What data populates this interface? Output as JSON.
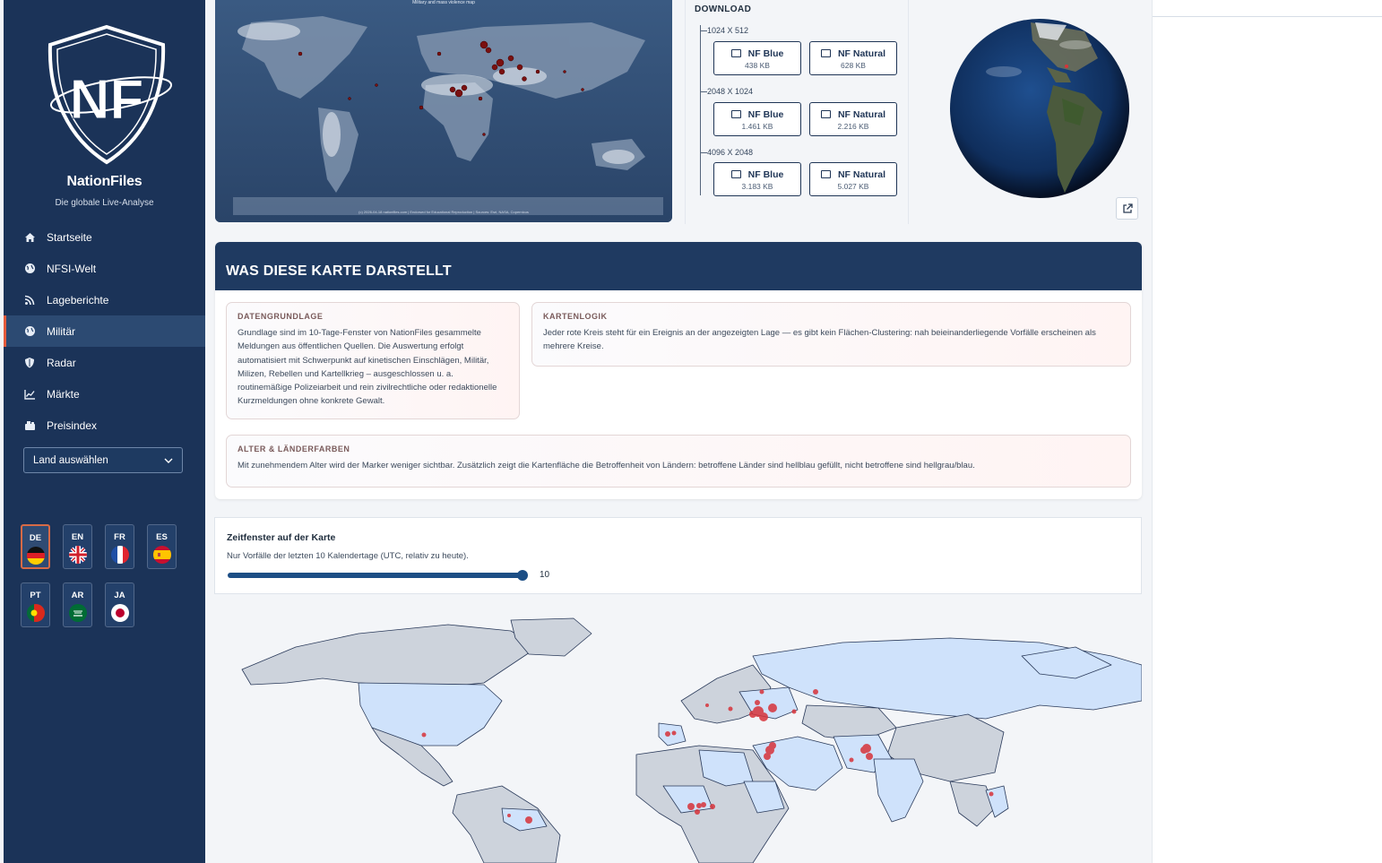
{
  "sidebar": {
    "brand": "NationFiles",
    "logo_text": "NF",
    "tagline": "Die globale Live-Analyse",
    "nav": [
      {
        "label": "Startseite",
        "icon": "home-icon"
      },
      {
        "label": "NFSI-Welt",
        "icon": "globe-icon"
      },
      {
        "label": "Lageberichte",
        "icon": "rss-icon"
      },
      {
        "label": "Militär",
        "icon": "globe-icon",
        "active": true
      },
      {
        "label": "Radar",
        "icon": "shield-icon"
      },
      {
        "label": "Märkte",
        "icon": "chart-line-icon"
      },
      {
        "label": "Preisindex",
        "icon": "cart-icon"
      }
    ],
    "country_select": "Land auswählen",
    "languages": [
      {
        "code": "DE",
        "active": true
      },
      {
        "code": "EN"
      },
      {
        "code": "FR"
      },
      {
        "code": "ES"
      },
      {
        "code": "PT"
      },
      {
        "code": "AR"
      },
      {
        "code": "JA"
      }
    ]
  },
  "flatmap": {
    "title": "Military and mass violence map",
    "credit": "(c) 2026-04-18 nationfiles.com | Endorsed for Educational Reproduction | Sources: Esri, NASA, Copernicus"
  },
  "download": {
    "title": "DOWNLOAD",
    "groups": [
      {
        "resolution": "1024 X 512",
        "blue_label": "NF Blue",
        "blue_size": "438 KB",
        "natural_label": "NF Natural",
        "natural_size": "628 KB"
      },
      {
        "resolution": "2048 X 1024",
        "blue_label": "NF Blue",
        "blue_size": "1.461 KB",
        "natural_label": "NF Natural",
        "natural_size": "2.216 KB"
      },
      {
        "resolution": "4096 X 2048",
        "blue_label": "NF Blue",
        "blue_size": "3.183 KB",
        "natural_label": "NF Natural",
        "natural_size": "5.027 KB"
      }
    ]
  },
  "explain": {
    "heading": "WAS DIESE KARTE DARSTELLT",
    "basis_title": "DATENGRUNDLAGE",
    "basis_text": "Grundlage sind im 10-Tage-Fenster von NationFiles gesammelte Meldungen aus öffentlichen Quellen. Die Auswertung erfolgt automatisiert mit Schwerpunkt auf kinetischen Einschlägen, Militär, Milizen, Rebellen und Kartellkrieg – ausgeschlossen u. a. routinemäßige Polizeiarbeit und rein zivilrechtliche oder redaktionelle Kurzmeldungen ohne konkrete Gewalt.",
    "logic_title": "KARTENLOGIK",
    "logic_text": "Jeder rote Kreis steht für ein Ereignis an der angezeigten Lage — es gibt kein Flächen-Clustering: nah beieinanderliegende Vorfälle erscheinen als mehrere Kreise.",
    "age_title": "ALTER & LÄNDERFARBEN",
    "age_text": "Mit zunehmendem Alter wird der Marker weniger sichtbar. Zusätzlich zeigt die Kartenfläche die Betroffenheit von Ländern: betroffene Länder sind hellblau gefüllt, nicht betroffene sind hellgrau/blau."
  },
  "timewindow": {
    "title": "Zeitfenster auf der Karte",
    "description": "Nur Vorfälle der letzten 10 Kalendertage (UTC, relativ zu heute).",
    "value": "10",
    "fraction": 1.0
  },
  "colors": {
    "sidebar": "#1b3358",
    "accent": "#e55a3a",
    "header": "#1f3a61",
    "marker": "#d7333a",
    "affected_country": "#cfe2fb",
    "unaffected_country": "#cdd3dc"
  }
}
